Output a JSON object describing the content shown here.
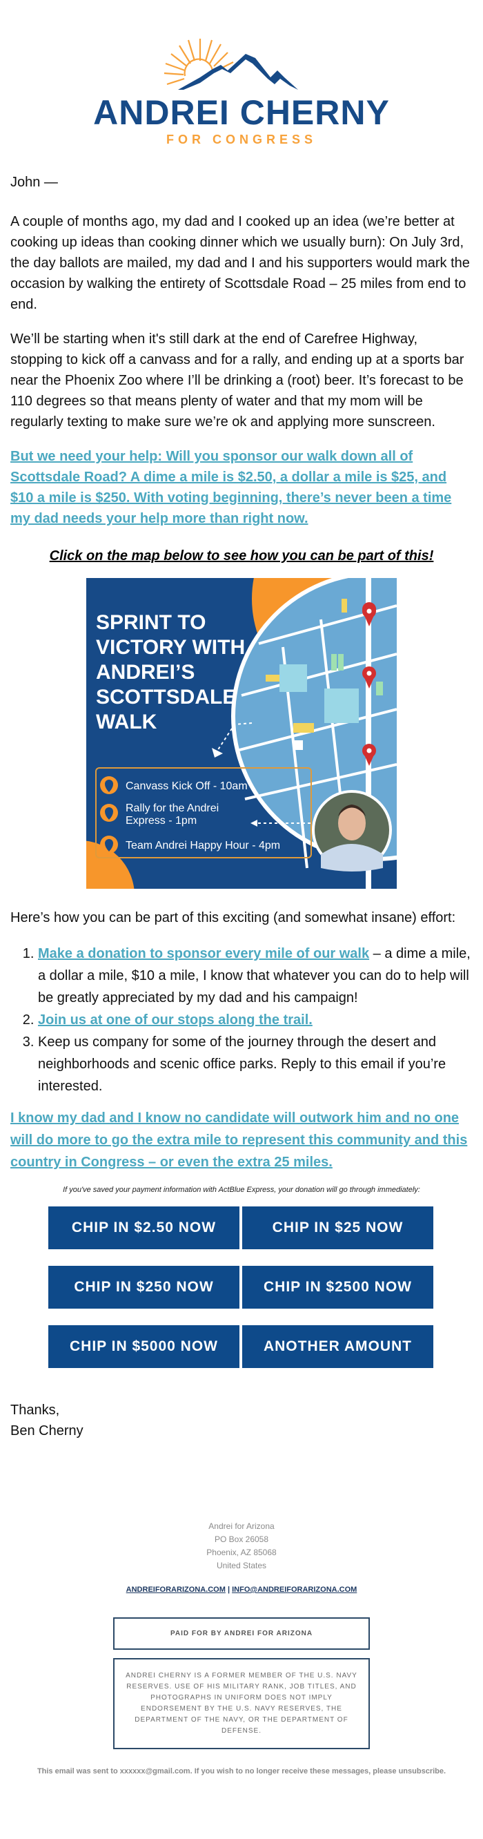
{
  "brand": {
    "name": "ANDREI CHERNY",
    "tagline": "FOR CONGRESS",
    "colors": {
      "navy": "#0e4a8a",
      "orange": "#f7a23b",
      "link": "#4ba8c0"
    }
  },
  "email": {
    "greeting": "John —",
    "paragraphs": [
      "A couple of months ago, my dad and I cooked up an idea (we’re better at cooking up ideas than cooking dinner which we usually burn): On July 3rd, the day ballots are mailed, my dad and I and his supporters would mark the occasion by walking the entirety of Scottsdale Road – 25 miles from end to end.",
      "We’ll be starting when it's still dark at the end of Carefree Highway, stopping to kick off a canvass and for a rally, and ending up at a sports bar near the Phoenix Zoo where I’ll be drinking a (root) beer. It’s forecast to be 110 degrees so that means plenty of water and that my mom will be regularly texting to make sure we’re ok and applying more sunscreen."
    ],
    "ask_link": "But we need your help: Will you sponsor our walk down all of Scottsdale Road? A dime a mile is $2.50, a dollar a mile is $25, and $10 a mile is $250. With voting beginning, there’s never been a time my dad needs your help more than right now.",
    "map_cta": "Click on the map below to see how you can be part of this!",
    "hero": {
      "title_lines": [
        "SPRINT TO",
        "VICTORY WITH",
        "ANDREI’S",
        "SCOTTSDALE",
        "WALK"
      ],
      "events": [
        "Canvass Kick Off - 10am",
        "Rally for the Andrei Express - 1pm",
        "Team Andrei Happy Hour - 4pm"
      ]
    },
    "list_intro": "Here’s how you can be part of this exciting (and somewhat insane) effort:",
    "list": [
      {
        "link": "Make a donation to sponsor every mile of our walk",
        "text": " – a dime a mile, a dollar a mile, $10 a mile, I know that whatever you can do to help will be greatly appreciated by my dad and his campaign!"
      },
      {
        "link": "Join us at one of our stops along the trail.",
        "text": ""
      },
      {
        "link": "",
        "text": "Keep us company for some of the journey through the desert and neighborhoods and scenic office parks. Reply to this email if you’re interested."
      }
    ],
    "closing_link": "I know my dad and I know no candidate will outwork him and no one will do more to go the extra mile to represent this community and this country in Congress – or even the extra 25 miles.",
    "express_note": "If you've saved your payment information with ActBlue Express, your donation will go through immediately:",
    "buttons": [
      "CHIP IN $2.50 NOW",
      "CHIP IN $25 NOW",
      "CHIP IN $250 NOW",
      "CHIP IN $2500 NOW",
      "CHIP IN $5000 NOW",
      "ANOTHER AMOUNT"
    ],
    "signoff": "Thanks,",
    "signature": "Ben Cherny"
  },
  "footer": {
    "org": "Andrei for Arizona",
    "address1": "PO Box 26058",
    "address2": "Phoenix, AZ 85068",
    "country": "United States",
    "website": "ANDREIFORARIZONA.COM",
    "separator": "|",
    "email": "INFO@ANDREIFORARIZONA.COM",
    "paid_for": "PAID FOR BY ANDREI FOR ARIZONA",
    "disclaimer": "ANDREI CHERNY IS A FORMER MEMBER OF THE U.S. NAVY RESERVES. USE OF HIS MILITARY RANK, JOB TITLES, AND PHOTOGRAPHS IN UNIFORM DOES NOT IMPLY ENDORSEMENT BY THE U.S. NAVY RESERVES, THE DEPARTMENT OF THE NAVY, OR THE DEPARTMENT OF DEFENSE.",
    "unsubscribe": "This email was sent to xxxxxx@gmail.com. If you wish to no longer receive these messages, please unsubscribe."
  }
}
